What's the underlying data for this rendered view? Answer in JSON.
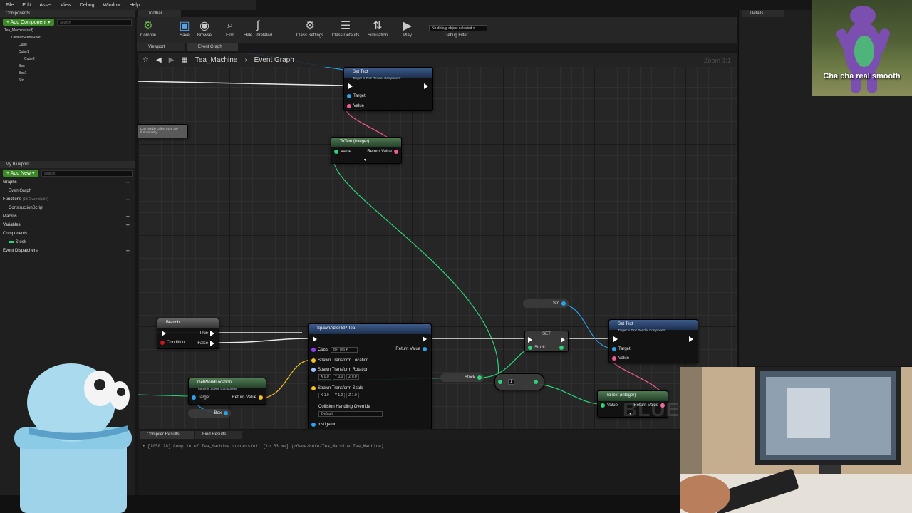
{
  "menu": [
    "File",
    "Edit",
    "Asset",
    "View",
    "Debug",
    "Window",
    "Help"
  ],
  "components_panel": {
    "tab": "Components",
    "add_button": "+ Add Component ▾",
    "search_placeholder": "Search",
    "tree": [
      "Tea_Machine(self)",
      "DefaultSceneRoot",
      "Cube",
      "Cube1",
      "Cube2",
      "Box",
      "Box1",
      "Sto"
    ]
  },
  "my_blueprint": {
    "tab": "My Blueprint",
    "add_button": "+ Add New ▾",
    "search_placeholder": "Search",
    "graphs_label": "Graphs",
    "event_graph": "EventGraph",
    "functions_label": "Functions",
    "functions_note": "(18 Overridable)",
    "construction_script": "ConstructionScript",
    "macros_label": "Macros",
    "variables_label": "Variables",
    "components_label": "Components",
    "stock_var": "Stock",
    "event_dispatchers_label": "Event Dispatchers"
  },
  "toolbar": {
    "tab": "Toolbar",
    "buttons": [
      "Compile",
      "Save",
      "Browse",
      "Find",
      "Hide Unrelated",
      "Class Settings",
      "Class Defaults",
      "Simulation",
      "Play"
    ],
    "debug_select": "No debug object selected ▾",
    "debug_filter": "Debug Filter"
  },
  "graph_tabs": [
    "Viewport",
    "Event Graph"
  ],
  "breadcrumb": {
    "root": "Tea_Machine",
    "current": "Event Graph"
  },
  "zoom_label": "Zoom 1:1",
  "watermark": "BLUEPRINT",
  "nodes": {
    "set_text_top": {
      "title": "Set Text",
      "subtitle": "Target is Text Render Component",
      "target": "Target",
      "value": "Value"
    },
    "totext_top": {
      "title": "ToText (integer)",
      "value": "Value",
      "return": "Return Value"
    },
    "comment": "Can not be called from the functionality",
    "branch": {
      "title": "Branch",
      "true": "True",
      "false": "False",
      "condition": "Condition"
    },
    "spawn": {
      "title": "SpawnActor BP Tea",
      "class": "Class",
      "class_value": "BP Tea ▾",
      "return": "Return Value",
      "location": "Spawn Transform Location",
      "rotation": "Spawn Transform Rotation",
      "rot_values": [
        "X 0.0",
        "Y 0.0",
        "Z 0.0"
      ],
      "scale": "Spawn Transform Scale",
      "scale_values": [
        "X 1.0",
        "Y 1.0",
        "Z 1.0"
      ],
      "collision": "Collision Handling Override",
      "collision_value": "Default",
      "instigator": "Instigator"
    },
    "getworld": {
      "title": "GetWorldLocation",
      "subtitle": "Target is Scene Component",
      "target": "Target",
      "return": "Return Value"
    },
    "box_var": "Box",
    "sto_var": "Sto",
    "set_node": {
      "title": "SET",
      "stock": "Stock"
    },
    "stock_var": "Stock",
    "plus_one": "1",
    "set_text_bottom": {
      "title": "Set Text",
      "subtitle": "Target is Text Render Component",
      "target": "Target",
      "value": "Value"
    },
    "totext_bottom": {
      "title": "ToText (integer)",
      "value": "Value",
      "return": "Return Value"
    }
  },
  "bottom_tabs": [
    "Compiler Results",
    "Find Results"
  ],
  "log_line": "• [1050.28] Compile of Tea_Machine successful! [in 53 ms] (/Game/bufe/Tea_Machine.Tea_Machine)",
  "details": {
    "tab": "Details"
  },
  "barney_caption": "Cha cha real smooth",
  "colors": {
    "exec": "#ffffff",
    "object": "#2aa2ee",
    "integer": "#2bd37a",
    "text": "#f25a93",
    "vector": "#f5c323",
    "bool": "#c8171d"
  }
}
